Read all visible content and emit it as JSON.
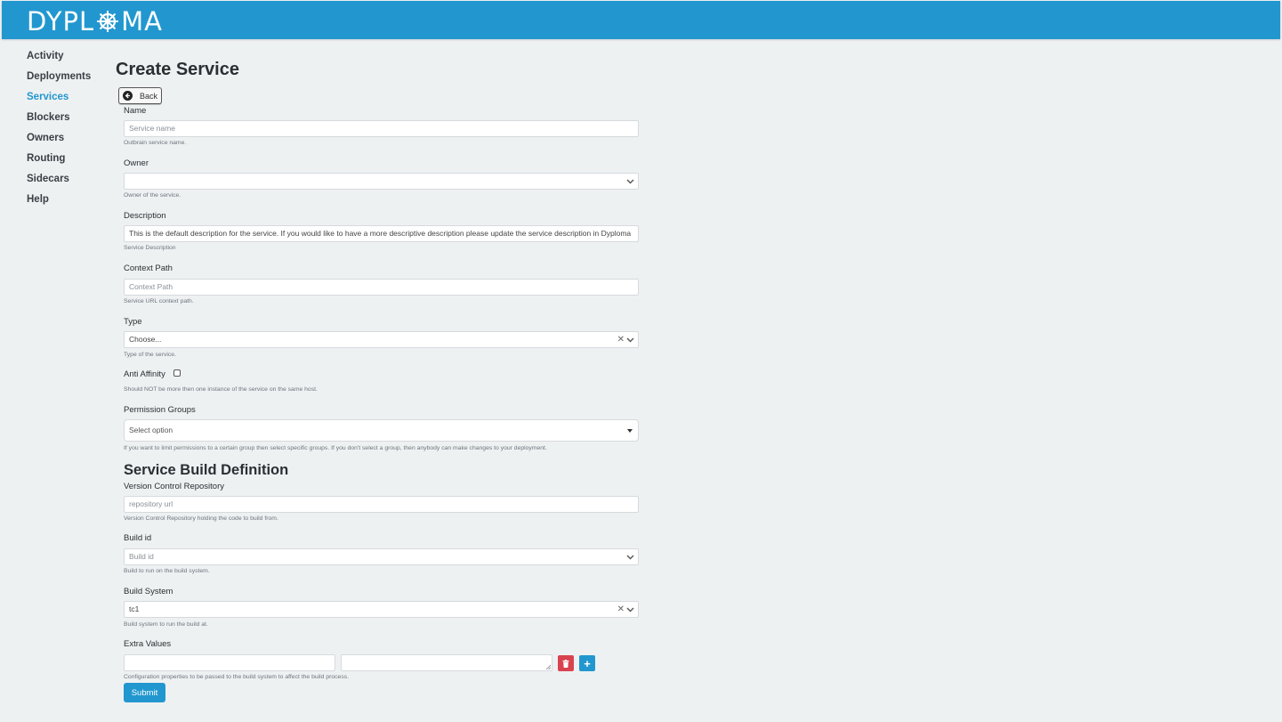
{
  "app": {
    "brand": "DYPL",
    "brand_suffix": "MA"
  },
  "sidebar": {
    "items": [
      {
        "label": "Activity",
        "active": false
      },
      {
        "label": "Deployments",
        "active": false
      },
      {
        "label": "Services",
        "active": true
      },
      {
        "label": "Blockers",
        "active": false
      },
      {
        "label": "Owners",
        "active": false
      },
      {
        "label": "Routing",
        "active": false
      },
      {
        "label": "Sidecars",
        "active": false
      },
      {
        "label": "Help",
        "active": false
      }
    ]
  },
  "page": {
    "title": "Create Service",
    "back_label": "Back"
  },
  "form": {
    "name": {
      "label": "Name",
      "placeholder": "Service name",
      "help": "Outbrain service name."
    },
    "owner": {
      "label": "Owner",
      "value": "",
      "help": "Owner of the service."
    },
    "description": {
      "label": "Description",
      "value": "This is the default description for the service. If you would like to have a more descriptive description please update the service description in Dyploma",
      "help": "Service Description"
    },
    "context_path": {
      "label": "Context Path",
      "placeholder": "Context Path",
      "help": "Service URL context path."
    },
    "type": {
      "label": "Type",
      "value": "Choose...",
      "help": "Type of the service."
    },
    "anti_affinity": {
      "label": "Anti Affinity",
      "checked": false,
      "help": "Should NOT be more then one instance of the service on the same host."
    },
    "permission_groups": {
      "label": "Permission Groups",
      "value": "Select option",
      "help": "If you want to limit permissions to a certain group then select specific groups. If you don't select a group, then anybody can make changes to your deployment."
    }
  },
  "build": {
    "section_title": "Service Build Definition",
    "repo": {
      "label": "Version Control Repository",
      "placeholder": "repository url",
      "help": "Version Control Repository holding the code to build from."
    },
    "build_id": {
      "label": "Build id",
      "placeholder": "Build id",
      "help": "Build to run on the build system."
    },
    "build_system": {
      "label": "Build System",
      "value": "tc1",
      "help": "Build system to run the build at."
    },
    "extra_values": {
      "label": "Extra Values",
      "key": "",
      "value": "",
      "help": "Configuration properties to be passed to the build system to affect the build process.",
      "add_label": "+"
    },
    "submit_label": "Submit"
  },
  "colors": {
    "brand": "#2297cf",
    "danger": "#d9434f",
    "background": "#eef1f2"
  },
  "icons": [
    "ship-wheel-icon",
    "back-arrow-icon",
    "chevron-down-icon",
    "clear-icon",
    "caret-down-icon",
    "trash-icon",
    "plus-icon"
  ]
}
